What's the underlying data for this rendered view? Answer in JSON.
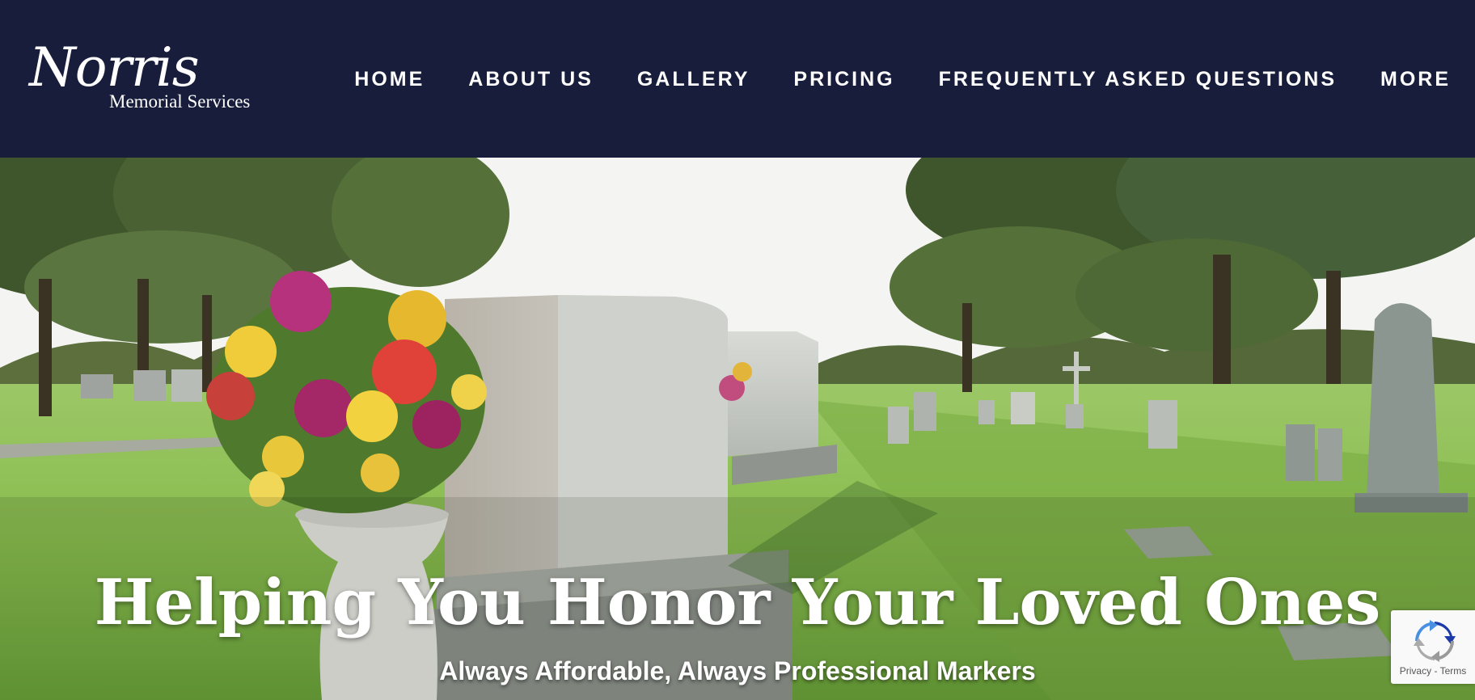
{
  "brand": {
    "name": "Norris",
    "tagline": "Memorial Services"
  },
  "nav": {
    "items": [
      {
        "label": "HOME"
      },
      {
        "label": "ABOUT US"
      },
      {
        "label": "GALLERY"
      },
      {
        "label": "PRICING"
      },
      {
        "label": "FREQUENTLY ASKED QUESTIONS"
      },
      {
        "label": "MORE"
      }
    ]
  },
  "hero": {
    "title": "Helping You Honor Your Loved Ones",
    "subtitle": "Always Affordable, Always Professional Markers"
  },
  "recaptcha": {
    "privacy": "Privacy",
    "separator": "-",
    "terms": "Terms"
  },
  "colors": {
    "header_bg": "#171d3b",
    "nav_text": "#ffffff",
    "grass": "#7fb34a",
    "sky": "#f4f5f2"
  }
}
